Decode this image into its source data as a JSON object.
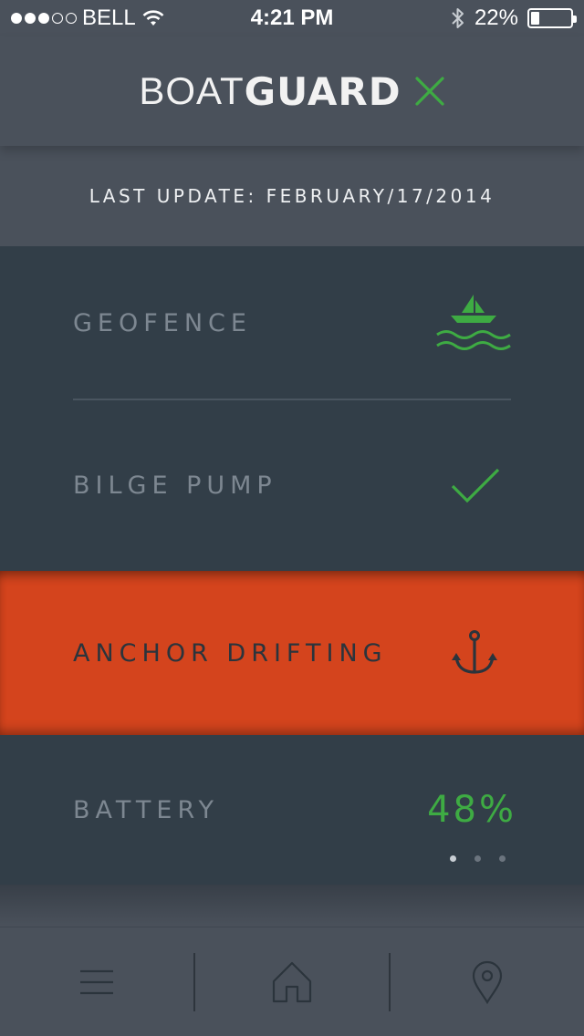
{
  "status_bar": {
    "carrier": "BELL",
    "time": "4:21 PM",
    "battery_percent": "22%",
    "battery_level": 0.22,
    "signal_bars_filled": 3,
    "signal_bars_total": 5
  },
  "header": {
    "logo_thin": "BOAT",
    "logo_bold": "GUARD",
    "logo_icon": "close-x-icon"
  },
  "last_update": "LAST UPDATE: FEBRUARY/17/2014",
  "panels": [
    {
      "label": "GEOFENCE",
      "icon": "boat-waves-icon",
      "state": "ok"
    },
    {
      "label": "BILGE PUMP",
      "icon": "checkmark-icon",
      "state": "ok"
    },
    {
      "label": "ANCHOR DRIFTING",
      "icon": "anchor-icon",
      "state": "alert"
    },
    {
      "label": "BATTERY",
      "value": "48%",
      "state": "ok"
    }
  ],
  "pager": {
    "pages": 3,
    "active": 0
  },
  "tab_bar": {
    "tabs": [
      "menu-icon",
      "home-icon",
      "location-pin-icon"
    ]
  },
  "colors": {
    "accent_green": "#3eab43",
    "alert_orange": "#d4441d",
    "panel_bg": "#323e48",
    "header_bg": "#4a515b"
  }
}
